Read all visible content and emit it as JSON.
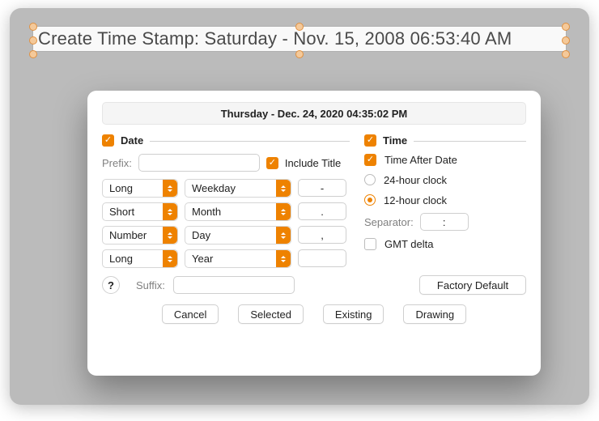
{
  "banner": "Create Time Stamp: Saturday - Nov. 15, 2008  06:53:40 AM",
  "preview": "Thursday - Dec. 24, 2020  04:35:02 PM",
  "date": {
    "header": "Date",
    "prefix_label": "Prefix:",
    "prefix_value": "",
    "include_title": "Include Title",
    "rows": [
      {
        "style": "Long",
        "part": "Weekday",
        "sep": "-"
      },
      {
        "style": "Short",
        "part": "Month",
        "sep": "."
      },
      {
        "style": "Number",
        "part": "Day",
        "sep": ","
      },
      {
        "style": "Long",
        "part": "Year",
        "sep": ""
      }
    ],
    "suffix_label": "Suffix:",
    "suffix_value": ""
  },
  "time": {
    "header": "Time",
    "after_date": "Time After Date",
    "clock24": "24-hour clock",
    "clock12": "12-hour clock",
    "sep_label": "Separator:",
    "sep_value": ":",
    "gmt": "GMT delta",
    "factory": "Factory Default"
  },
  "help": "?",
  "buttons": {
    "cancel": "Cancel",
    "selected": "Selected",
    "existing": "Existing",
    "drawing": "Drawing"
  }
}
